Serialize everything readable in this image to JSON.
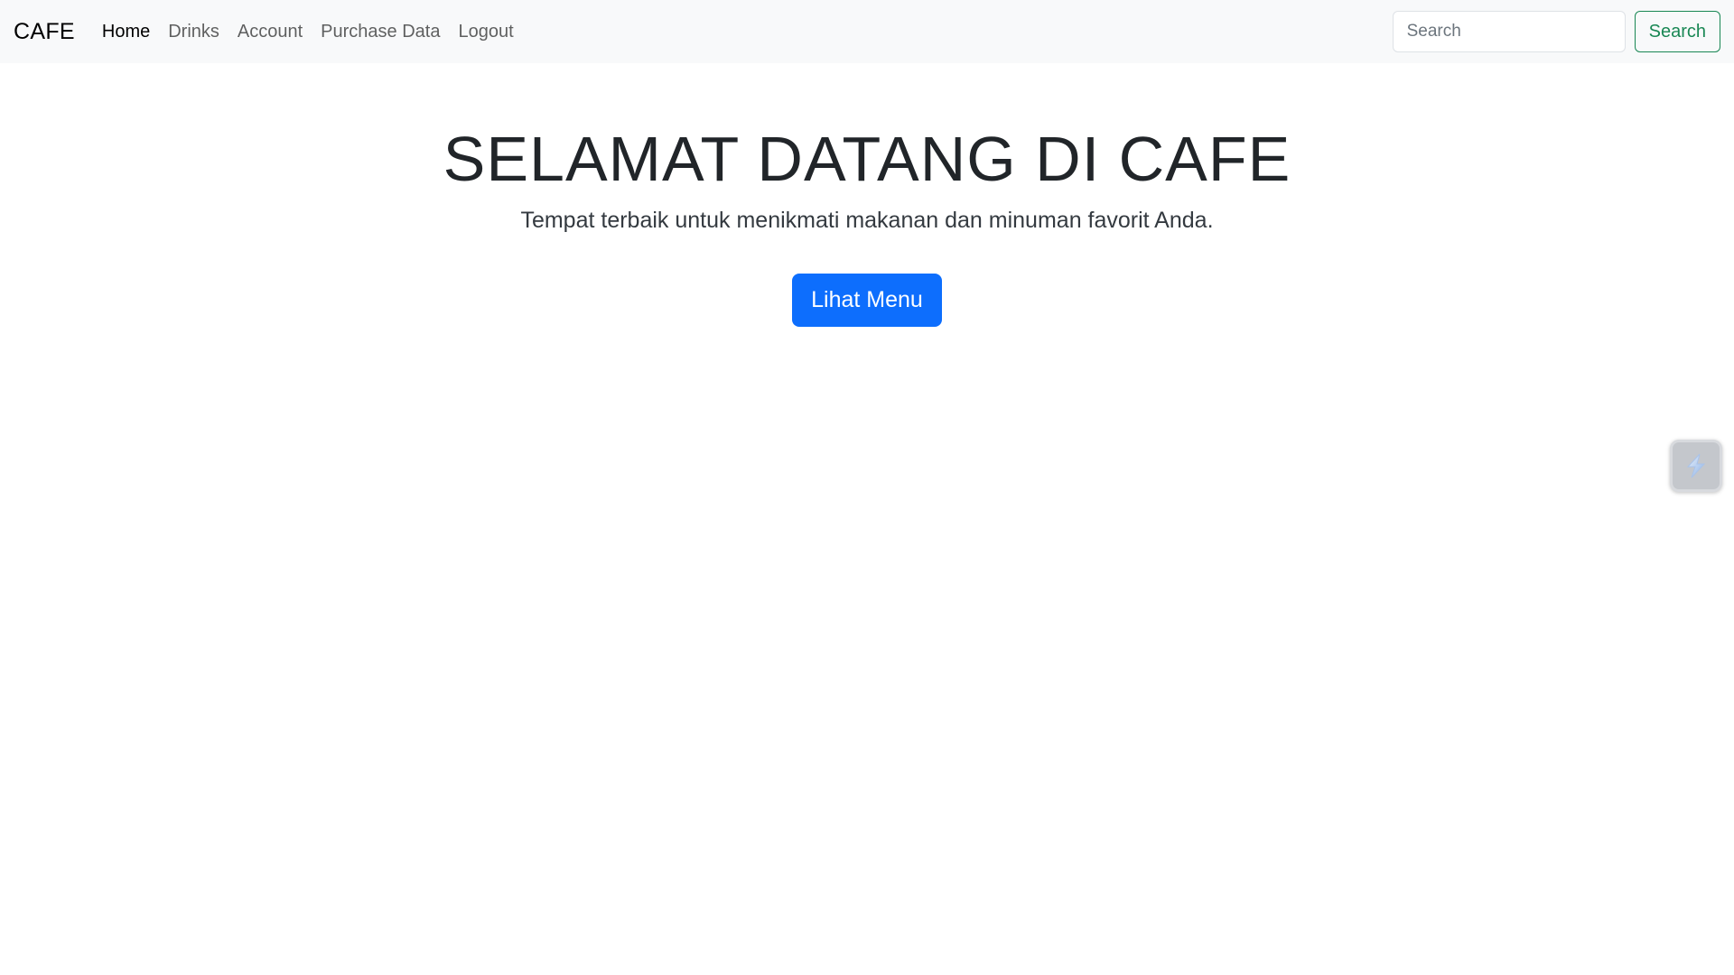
{
  "navbar": {
    "brand": "CAFE",
    "links": [
      {
        "label": "Home",
        "active": true
      },
      {
        "label": "Drinks",
        "active": false
      },
      {
        "label": "Account",
        "active": false
      },
      {
        "label": "Purchase Data",
        "active": false
      },
      {
        "label": "Logout",
        "active": false
      }
    ],
    "search": {
      "placeholder": "Search",
      "value": "",
      "button_label": "Search"
    }
  },
  "hero": {
    "title": "SELAMAT DATANG DI CAFE",
    "lead": "Tempat terbaik untuk menikmati makanan dan minuman favorit Anda.",
    "button_label": "Lihat Menu"
  },
  "floating_widget": {
    "icon": "lightning-icon"
  },
  "colors": {
    "navbar_bg": "#f8f9fa",
    "primary": "#0d6efd",
    "success": "#198754"
  }
}
